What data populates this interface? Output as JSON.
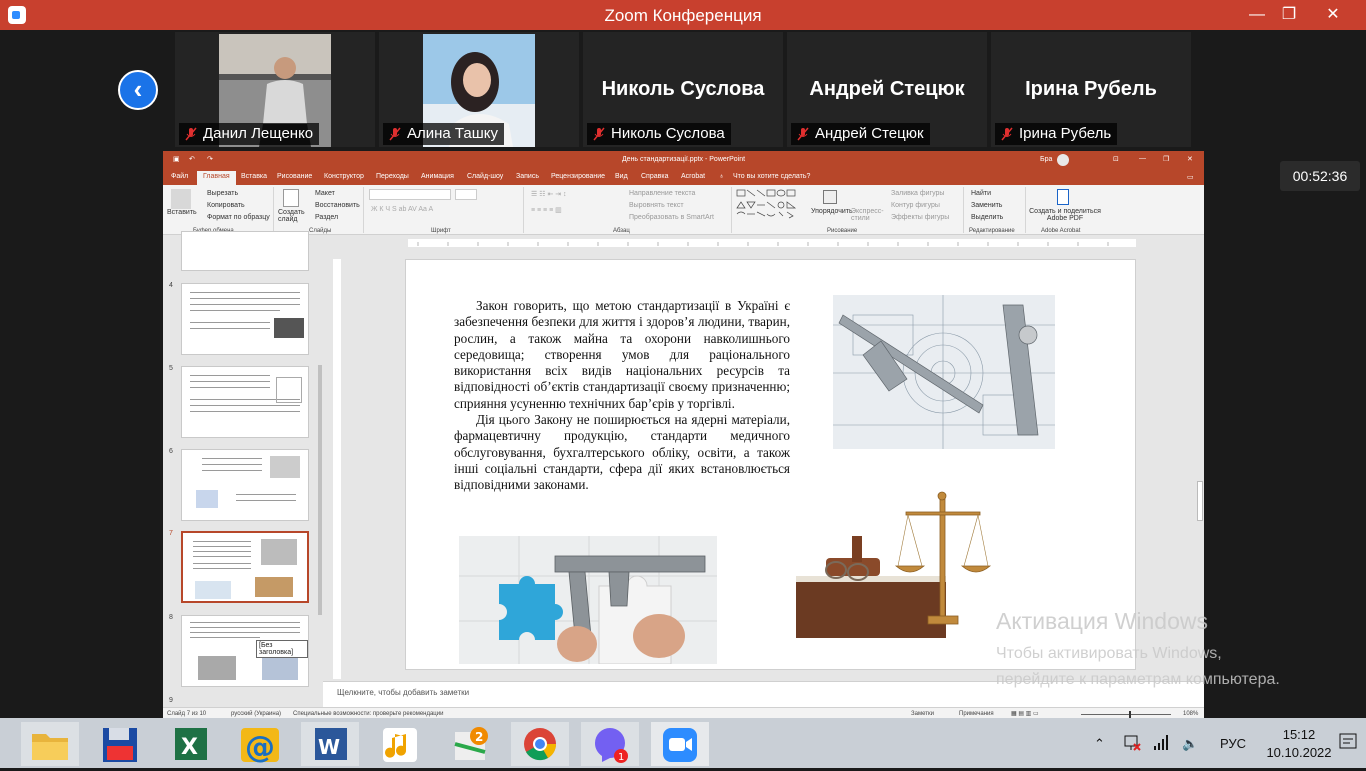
{
  "zoom": {
    "title": "Zoom Конференция",
    "timer": "00:52:36",
    "participants": [
      {
        "name": "Данил Лещенко",
        "display": ""
      },
      {
        "name": "Алина Ташку",
        "display": ""
      },
      {
        "name": "Николь Суслова",
        "display": "Николь Суслова"
      },
      {
        "name": "Андрей Стецюк",
        "display": "Андрей Стецюк"
      },
      {
        "name": "Ірина Рубель",
        "display": "Ірина Рубель"
      }
    ]
  },
  "ppt": {
    "file_title": "День стандартизації.pptx  -  PowerPoint",
    "user": "Бра",
    "tabs": [
      "Файл",
      "Главная",
      "Вставка",
      "Рисование",
      "Конструктор",
      "Переходы",
      "Анимация",
      "Слайд-шоу",
      "Запись",
      "Рецензирование",
      "Вид",
      "Справка",
      "Acrobat"
    ],
    "tell_me": "Что вы хотите сделать?",
    "ribbon": {
      "paste": "Вставить",
      "cut": "Вырезать",
      "copy": "Копировать",
      "format_painter": "Формат по образцу",
      "clipboard": "Буфер обмена",
      "new_slide": "Создать слайд",
      "layout": "Макет",
      "reset": "Восстановить",
      "section": "Раздел",
      "slides": "Слайды",
      "font": "Шрифт",
      "text_direction": "Направление текста",
      "align_text": "Выровнять текст",
      "smartart": "Преобразовать в SmartArt",
      "paragraph": "Абзац",
      "arrange": "Упорядочить",
      "quick_styles": "Экспресс-стили",
      "shape_fill": "Заливка фигуры",
      "shape_outline": "Контур фигуры",
      "shape_effects": "Эффекты фигуры",
      "drawing": "Рисование",
      "find": "Найти",
      "replace": "Заменить",
      "select": "Выделить",
      "editing": "Редактирование",
      "adobe": "Создать и поделиться Adobe PDF",
      "adobe_group": "Adobe Acrobat"
    },
    "thumbs": [
      "4",
      "5",
      "6",
      "7",
      "8",
      "9"
    ],
    "tooltip": "[Без заголовка]",
    "slide_text_p1": "Закон говорить, що метою стандартизації в Україні є забезпечення безпеки для життя і здоров’я людини, тварин, рослин, а також майна та охорони навколишнього середовища; створення умов для раціонального використання всіх видів національних ресурсів та відповідності об’єктів стандартизації своєму призначенню; сприяння усуненню технічних бар’єрів у торгівлі.",
    "slide_text_p2": "Дія цього Закону не поширюється на ядерні матеріали, фармацевтичну продукцію, стандарти медичного обслуговування, бухгалтерського обліку, освіти, а також інші соціальні стандарти, сфера дії яких встановлюється відповідними законами.",
    "notes_placeholder": "Щелкните, чтобы добавить заметки",
    "status": {
      "slide": "Слайд 7 из 10",
      "lang": "русский (Украина)",
      "accessibility": "Специальные возможности: проверьте рекомендации",
      "notes": "Заметки",
      "comments": "Примечания",
      "zoom": "108%"
    }
  },
  "activation": {
    "title": "Активация Windows",
    "line1": "Чтобы активировать Windows,",
    "line2": "перейдите к параметрам компьютера."
  },
  "taskbar": {
    "lang": "РУС",
    "time": "15:12",
    "date": "10.10.2022",
    "viber_badge": "1",
    "flag_badge": "2"
  }
}
